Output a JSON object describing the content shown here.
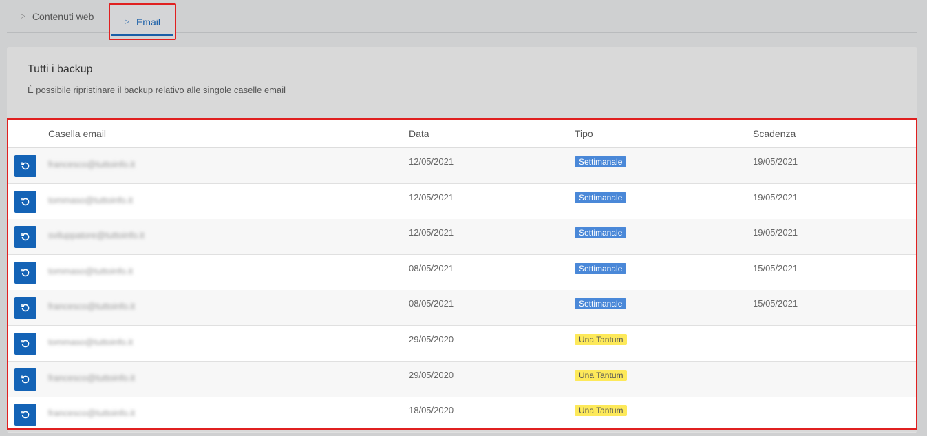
{
  "tabs": [
    {
      "label": "Contenuti web"
    },
    {
      "label": "Email"
    }
  ],
  "card": {
    "title": "Tutti i backup",
    "subtitle": "È possibile ripristinare il backup relativo alle singole caselle email"
  },
  "table": {
    "headers": {
      "email": "Casella email",
      "date": "Data",
      "type": "Tipo",
      "expiry": "Scadenza"
    },
    "rows": [
      {
        "email": "francesco@tuttoinfo.it",
        "date": "12/05/2021",
        "type": "Settimanale",
        "expiry": "19/05/2021"
      },
      {
        "email": "tommaso@tuttoinfo.it",
        "date": "12/05/2021",
        "type": "Settimanale",
        "expiry": "19/05/2021"
      },
      {
        "email": "sviluppatore@tuttoinfo.it",
        "date": "12/05/2021",
        "type": "Settimanale",
        "expiry": "19/05/2021"
      },
      {
        "email": "tommaso@tuttoinfo.it",
        "date": "08/05/2021",
        "type": "Settimanale",
        "expiry": "15/05/2021"
      },
      {
        "email": "francesco@tuttoinfo.it",
        "date": "08/05/2021",
        "type": "Settimanale",
        "expiry": "15/05/2021"
      },
      {
        "email": "tommaso@tuttoinfo.it",
        "date": "29/05/2020",
        "type": "Una Tantum",
        "expiry": ""
      },
      {
        "email": "francesco@tuttoinfo.it",
        "date": "29/05/2020",
        "type": "Una Tantum",
        "expiry": ""
      },
      {
        "email": "francesco@tuttoinfo.it",
        "date": "18/05/2020",
        "type": "Una Tantum",
        "expiry": ""
      }
    ]
  },
  "icons": {
    "tab": "triangle-right-icon",
    "restore": "restore-icon"
  },
  "colors": {
    "accent": "#1463b6",
    "weekly_badge": "#4a88d8",
    "once_badge": "#fde95a",
    "highlight": "#e02020"
  }
}
